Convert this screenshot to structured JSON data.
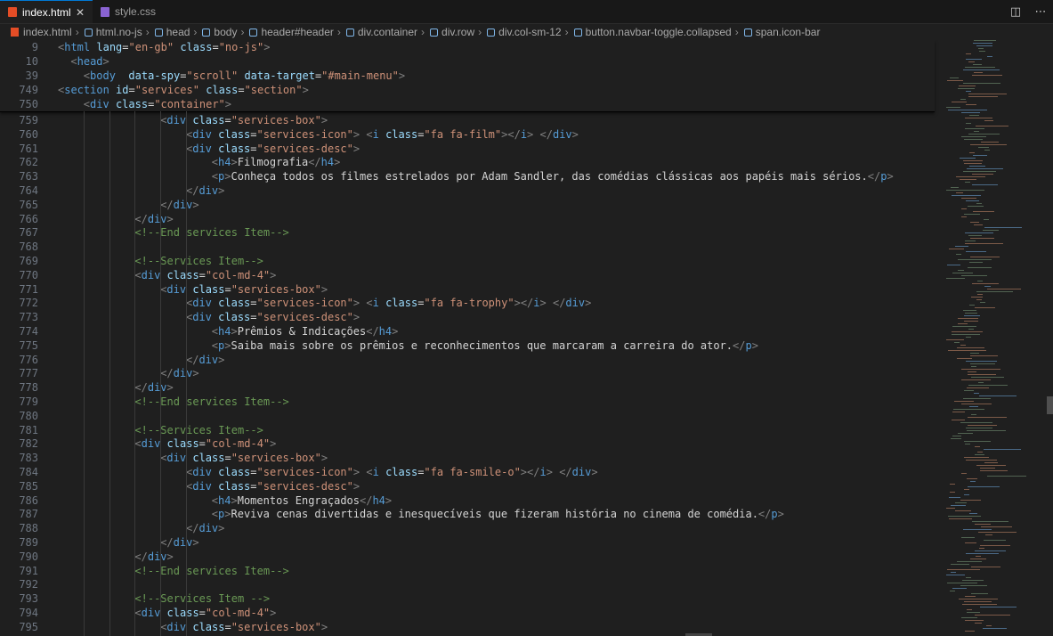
{
  "tabs": [
    {
      "label": "index.html",
      "icon": "html5-icon",
      "active": true
    },
    {
      "label": "style.css",
      "icon": "css-icon",
      "active": false
    }
  ],
  "breadcrumb": [
    "index.html",
    "html.no-js",
    "head",
    "body",
    "header#header",
    "div.container",
    "div.row",
    "div.col-sm-12",
    "button.navbar-toggle.collapsed",
    "span.icon-bar"
  ],
  "sticky_lines": [
    {
      "num": "9",
      "indent": 0,
      "parts": [
        [
          "br",
          "<"
        ],
        [
          "tag",
          "html"
        ],
        [
          "txt",
          " "
        ],
        [
          "attr",
          "lang"
        ],
        [
          "txt",
          "="
        ],
        [
          "str",
          "\"en-gb\""
        ],
        [
          "txt",
          " "
        ],
        [
          "attr",
          "class"
        ],
        [
          "txt",
          "="
        ],
        [
          "str",
          "\"no-js\""
        ],
        [
          "br",
          ">"
        ]
      ]
    },
    {
      "num": "10",
      "indent": 1,
      "parts": [
        [
          "br",
          "<"
        ],
        [
          "tag",
          "head"
        ],
        [
          "br",
          ">"
        ]
      ]
    },
    {
      "num": "39",
      "indent": 2,
      "parts": [
        [
          "br",
          "<"
        ],
        [
          "tag",
          "body"
        ],
        [
          "txt",
          "  "
        ],
        [
          "attr",
          "data-spy"
        ],
        [
          "txt",
          "="
        ],
        [
          "str",
          "\"scroll\""
        ],
        [
          "txt",
          " "
        ],
        [
          "attr",
          "data-target"
        ],
        [
          "txt",
          "="
        ],
        [
          "str",
          "\"#main-menu\""
        ],
        [
          "br",
          ">"
        ]
      ]
    },
    {
      "num": "749",
      "indent": 0,
      "parts": [
        [
          "br",
          "<"
        ],
        [
          "tag",
          "section"
        ],
        [
          "txt",
          " "
        ],
        [
          "attr",
          "id"
        ],
        [
          "txt",
          "="
        ],
        [
          "str",
          "\"services\""
        ],
        [
          "txt",
          " "
        ],
        [
          "attr",
          "class"
        ],
        [
          "txt",
          "="
        ],
        [
          "str",
          "\"section\""
        ],
        [
          "br",
          ">"
        ]
      ]
    },
    {
      "num": "750",
      "indent": 2,
      "parts": [
        [
          "br",
          "<"
        ],
        [
          "tag",
          "div"
        ],
        [
          "txt",
          " "
        ],
        [
          "attr",
          "class"
        ],
        [
          "txt",
          "="
        ],
        [
          "str",
          "\"container\""
        ],
        [
          "br",
          ">"
        ]
      ]
    }
  ],
  "lines": [
    {
      "num": "759",
      "indent": 8,
      "parts": [
        [
          "br",
          "<"
        ],
        [
          "tag",
          "div"
        ],
        [
          "txt",
          " "
        ],
        [
          "attr",
          "class"
        ],
        [
          "txt",
          "="
        ],
        [
          "str",
          "\"services-box\""
        ],
        [
          "br",
          ">"
        ]
      ]
    },
    {
      "num": "760",
      "indent": 10,
      "parts": [
        [
          "br",
          "<"
        ],
        [
          "tag",
          "div"
        ],
        [
          "txt",
          " "
        ],
        [
          "attr",
          "class"
        ],
        [
          "txt",
          "="
        ],
        [
          "str",
          "\"services-icon\""
        ],
        [
          "br",
          ">"
        ],
        [
          "txt",
          " "
        ],
        [
          "br",
          "<"
        ],
        [
          "tag",
          "i"
        ],
        [
          "txt",
          " "
        ],
        [
          "attr",
          "class"
        ],
        [
          "txt",
          "="
        ],
        [
          "str",
          "\"fa fa-film\""
        ],
        [
          "br",
          ">"
        ],
        [
          "br",
          "</"
        ],
        [
          "tag",
          "i"
        ],
        [
          "br",
          ">"
        ],
        [
          "txt",
          " "
        ],
        [
          "br",
          "</"
        ],
        [
          "tag",
          "div"
        ],
        [
          "br",
          ">"
        ]
      ]
    },
    {
      "num": "761",
      "indent": 10,
      "parts": [
        [
          "br",
          "<"
        ],
        [
          "tag",
          "div"
        ],
        [
          "txt",
          " "
        ],
        [
          "attr",
          "class"
        ],
        [
          "txt",
          "="
        ],
        [
          "str",
          "\"services-desc\""
        ],
        [
          "br",
          ">"
        ]
      ]
    },
    {
      "num": "762",
      "indent": 12,
      "parts": [
        [
          "br",
          "<"
        ],
        [
          "tag",
          "h4"
        ],
        [
          "br",
          ">"
        ],
        [
          "txt",
          "Filmografia"
        ],
        [
          "br",
          "</"
        ],
        [
          "tag",
          "h4"
        ],
        [
          "br",
          ">"
        ]
      ]
    },
    {
      "num": "763",
      "indent": 12,
      "parts": [
        [
          "br",
          "<"
        ],
        [
          "tag",
          "p"
        ],
        [
          "br",
          ">"
        ],
        [
          "txt",
          "Conheça todos os filmes estrelados por Adam Sandler, das comédias clássicas aos papéis mais sérios."
        ],
        [
          "br",
          "</"
        ],
        [
          "tag",
          "p"
        ],
        [
          "br",
          ">"
        ]
      ]
    },
    {
      "num": "764",
      "indent": 10,
      "parts": [
        [
          "br",
          "</"
        ],
        [
          "tag",
          "div"
        ],
        [
          "br",
          ">"
        ]
      ]
    },
    {
      "num": "765",
      "indent": 8,
      "parts": [
        [
          "br",
          "</"
        ],
        [
          "tag",
          "div"
        ],
        [
          "br",
          ">"
        ]
      ]
    },
    {
      "num": "766",
      "indent": 6,
      "parts": [
        [
          "br",
          "</"
        ],
        [
          "tag",
          "div"
        ],
        [
          "br",
          ">"
        ]
      ]
    },
    {
      "num": "767",
      "indent": 6,
      "parts": [
        [
          "cmt",
          "<!--End services Item-->"
        ]
      ]
    },
    {
      "num": "768",
      "indent": 0,
      "parts": []
    },
    {
      "num": "769",
      "indent": 6,
      "parts": [
        [
          "cmt",
          "<!--Services Item-->"
        ]
      ]
    },
    {
      "num": "770",
      "indent": 6,
      "parts": [
        [
          "br",
          "<"
        ],
        [
          "tag",
          "div"
        ],
        [
          "txt",
          " "
        ],
        [
          "attr",
          "class"
        ],
        [
          "txt",
          "="
        ],
        [
          "str",
          "\"col-md-4\""
        ],
        [
          "br",
          ">"
        ]
      ]
    },
    {
      "num": "771",
      "indent": 8,
      "parts": [
        [
          "br",
          "<"
        ],
        [
          "tag",
          "div"
        ],
        [
          "txt",
          " "
        ],
        [
          "attr",
          "class"
        ],
        [
          "txt",
          "="
        ],
        [
          "str",
          "\"services-box\""
        ],
        [
          "br",
          ">"
        ]
      ]
    },
    {
      "num": "772",
      "indent": 10,
      "parts": [
        [
          "br",
          "<"
        ],
        [
          "tag",
          "div"
        ],
        [
          "txt",
          " "
        ],
        [
          "attr",
          "class"
        ],
        [
          "txt",
          "="
        ],
        [
          "str",
          "\"services-icon\""
        ],
        [
          "br",
          ">"
        ],
        [
          "txt",
          " "
        ],
        [
          "br",
          "<"
        ],
        [
          "tag",
          "i"
        ],
        [
          "txt",
          " "
        ],
        [
          "attr",
          "class"
        ],
        [
          "txt",
          "="
        ],
        [
          "str",
          "\"fa fa-trophy\""
        ],
        [
          "br",
          ">"
        ],
        [
          "br",
          "</"
        ],
        [
          "tag",
          "i"
        ],
        [
          "br",
          ">"
        ],
        [
          "txt",
          " "
        ],
        [
          "br",
          "</"
        ],
        [
          "tag",
          "div"
        ],
        [
          "br",
          ">"
        ]
      ]
    },
    {
      "num": "773",
      "indent": 10,
      "parts": [
        [
          "br",
          "<"
        ],
        [
          "tag",
          "div"
        ],
        [
          "txt",
          " "
        ],
        [
          "attr",
          "class"
        ],
        [
          "txt",
          "="
        ],
        [
          "str",
          "\"services-desc\""
        ],
        [
          "br",
          ">"
        ]
      ]
    },
    {
      "num": "774",
      "indent": 12,
      "parts": [
        [
          "br",
          "<"
        ],
        [
          "tag",
          "h4"
        ],
        [
          "br",
          ">"
        ],
        [
          "txt",
          "Prêmios & Indicações"
        ],
        [
          "br",
          "</"
        ],
        [
          "tag",
          "h4"
        ],
        [
          "br",
          ">"
        ]
      ]
    },
    {
      "num": "775",
      "indent": 12,
      "parts": [
        [
          "br",
          "<"
        ],
        [
          "tag",
          "p"
        ],
        [
          "br",
          ">"
        ],
        [
          "txt",
          "Saiba mais sobre os prêmios e reconhecimentos que marcaram a carreira do ator."
        ],
        [
          "br",
          "</"
        ],
        [
          "tag",
          "p"
        ],
        [
          "br",
          ">"
        ]
      ]
    },
    {
      "num": "776",
      "indent": 10,
      "parts": [
        [
          "br",
          "</"
        ],
        [
          "tag",
          "div"
        ],
        [
          "br",
          ">"
        ]
      ]
    },
    {
      "num": "777",
      "indent": 8,
      "parts": [
        [
          "br",
          "</"
        ],
        [
          "tag",
          "div"
        ],
        [
          "br",
          ">"
        ]
      ]
    },
    {
      "num": "778",
      "indent": 6,
      "parts": [
        [
          "br",
          "</"
        ],
        [
          "tag",
          "div"
        ],
        [
          "br",
          ">"
        ]
      ]
    },
    {
      "num": "779",
      "indent": 6,
      "parts": [
        [
          "cmt",
          "<!--End services Item-->"
        ]
      ]
    },
    {
      "num": "780",
      "indent": 0,
      "parts": []
    },
    {
      "num": "781",
      "indent": 6,
      "parts": [
        [
          "cmt",
          "<!--Services Item-->"
        ]
      ]
    },
    {
      "num": "782",
      "indent": 6,
      "parts": [
        [
          "br",
          "<"
        ],
        [
          "tag",
          "div"
        ],
        [
          "txt",
          " "
        ],
        [
          "attr",
          "class"
        ],
        [
          "txt",
          "="
        ],
        [
          "str",
          "\"col-md-4\""
        ],
        [
          "br",
          ">"
        ]
      ]
    },
    {
      "num": "783",
      "indent": 8,
      "parts": [
        [
          "br",
          "<"
        ],
        [
          "tag",
          "div"
        ],
        [
          "txt",
          " "
        ],
        [
          "attr",
          "class"
        ],
        [
          "txt",
          "="
        ],
        [
          "str",
          "\"services-box\""
        ],
        [
          "br",
          ">"
        ]
      ]
    },
    {
      "num": "784",
      "indent": 10,
      "parts": [
        [
          "br",
          "<"
        ],
        [
          "tag",
          "div"
        ],
        [
          "txt",
          " "
        ],
        [
          "attr",
          "class"
        ],
        [
          "txt",
          "="
        ],
        [
          "str",
          "\"services-icon\""
        ],
        [
          "br",
          ">"
        ],
        [
          "txt",
          " "
        ],
        [
          "br",
          "<"
        ],
        [
          "tag",
          "i"
        ],
        [
          "txt",
          " "
        ],
        [
          "attr",
          "class"
        ],
        [
          "txt",
          "="
        ],
        [
          "str",
          "\"fa fa-smile-o\""
        ],
        [
          "br",
          ">"
        ],
        [
          "br",
          "</"
        ],
        [
          "tag",
          "i"
        ],
        [
          "br",
          ">"
        ],
        [
          "txt",
          " "
        ],
        [
          "br",
          "</"
        ],
        [
          "tag",
          "div"
        ],
        [
          "br",
          ">"
        ]
      ]
    },
    {
      "num": "785",
      "indent": 10,
      "parts": [
        [
          "br",
          "<"
        ],
        [
          "tag",
          "div"
        ],
        [
          "txt",
          " "
        ],
        [
          "attr",
          "class"
        ],
        [
          "txt",
          "="
        ],
        [
          "str",
          "\"services-desc\""
        ],
        [
          "br",
          ">"
        ]
      ]
    },
    {
      "num": "786",
      "indent": 12,
      "parts": [
        [
          "br",
          "<"
        ],
        [
          "tag",
          "h4"
        ],
        [
          "br",
          ">"
        ],
        [
          "txt",
          "Momentos Engraçados"
        ],
        [
          "br",
          "</"
        ],
        [
          "tag",
          "h4"
        ],
        [
          "br",
          ">"
        ]
      ]
    },
    {
      "num": "787",
      "indent": 12,
      "parts": [
        [
          "br",
          "<"
        ],
        [
          "tag",
          "p"
        ],
        [
          "br",
          ">"
        ],
        [
          "txt",
          "Reviva cenas divertidas e inesquecíveis que fizeram história no cinema de comédia."
        ],
        [
          "br",
          "</"
        ],
        [
          "tag",
          "p"
        ],
        [
          "br",
          ">"
        ]
      ]
    },
    {
      "num": "788",
      "indent": 10,
      "parts": [
        [
          "br",
          "</"
        ],
        [
          "tag",
          "div"
        ],
        [
          "br",
          ">"
        ]
      ]
    },
    {
      "num": "789",
      "indent": 8,
      "parts": [
        [
          "br",
          "</"
        ],
        [
          "tag",
          "div"
        ],
        [
          "br",
          ">"
        ]
      ]
    },
    {
      "num": "790",
      "indent": 6,
      "parts": [
        [
          "br",
          "</"
        ],
        [
          "tag",
          "div"
        ],
        [
          "br",
          ">"
        ]
      ]
    },
    {
      "num": "791",
      "indent": 6,
      "parts": [
        [
          "cmt",
          "<!--End services Item-->"
        ]
      ]
    },
    {
      "num": "792",
      "indent": 0,
      "parts": []
    },
    {
      "num": "793",
      "indent": 6,
      "parts": [
        [
          "cmt",
          "<!--Services Item -->"
        ]
      ]
    },
    {
      "num": "794",
      "indent": 6,
      "parts": [
        [
          "br",
          "<"
        ],
        [
          "tag",
          "div"
        ],
        [
          "txt",
          " "
        ],
        [
          "attr",
          "class"
        ],
        [
          "txt",
          "="
        ],
        [
          "str",
          "\"col-md-4\""
        ],
        [
          "br",
          ">"
        ]
      ]
    },
    {
      "num": "795",
      "indent": 8,
      "parts": [
        [
          "br",
          "<"
        ],
        [
          "tag",
          "div"
        ],
        [
          "txt",
          " "
        ],
        [
          "attr",
          "class"
        ],
        [
          "txt",
          "="
        ],
        [
          "str",
          "\"services-box\""
        ],
        [
          "br",
          ">"
        ]
      ]
    }
  ],
  "colors": {
    "tag": "#569cd6",
    "attr": "#9cdcfe",
    "string": "#ce9178",
    "comment": "#6a9955",
    "text": "#d4d4d4",
    "bracket": "#808080"
  }
}
